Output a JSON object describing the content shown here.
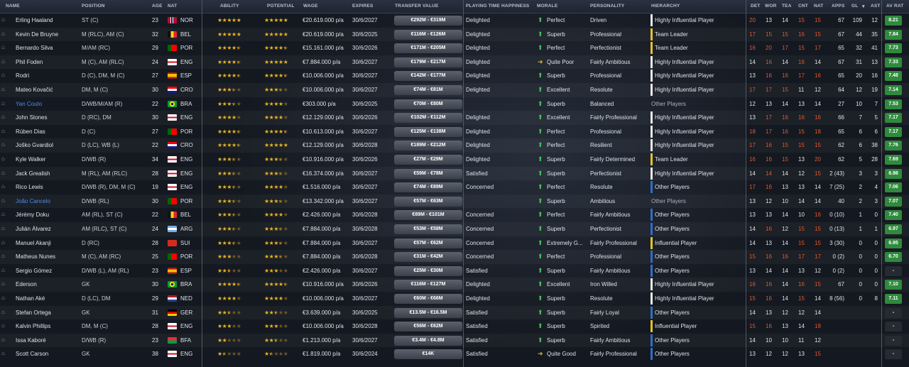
{
  "columns": {
    "name": "NAME",
    "position": "POSITION",
    "age": "AGE",
    "nat": "NAT",
    "ability": "ABILITY",
    "potential": "POTENTIAL",
    "wage": "WAGE",
    "expires": "EXPIRES",
    "transfer_value": "TRANSFER VALUE",
    "pt_happiness": "PLAYING TIME HAPPINESS",
    "morale": "MORALE",
    "personality": "PERSONALITY",
    "hierarchy": "HIERARCHY",
    "det": "DET",
    "wor": "WOR",
    "tea": "TEA",
    "cnt": "CNT",
    "nat2": "NAT",
    "apps": "APPS",
    "gls": "GL",
    "ast": "AST",
    "av_rat": "AV RAT"
  },
  "colors": {
    "star": "#e6b423",
    "arrow_up": "#4fc25a",
    "arrow_side": "#d8b32c",
    "bar_white": "#e8e8e8",
    "bar_yellow": "#e3c32c",
    "bar_blue": "#2f6fc6",
    "attr_red": "#e2592f",
    "rating_green": "#2f8a3d",
    "rating_dark": "#252b33",
    "link": "#4a8fe8"
  },
  "players": [
    {
      "name": "Erling Haaland",
      "pos": "ST (C)",
      "age": "23",
      "flag": "NOR",
      "nat": "NOR",
      "ab": 5,
      "pot": 5,
      "wage": "€20.619.000 p/a",
      "exp": "30/6/2027",
      "tv": "€292M - €319M",
      "pth": "Delighted",
      "mor": "Perfect",
      "arrow": "up",
      "pers": "Driven",
      "hier": "Highly Influential Player",
      "bar": "white",
      "det": "20",
      "wor": "13",
      "tea": "14",
      "cnt": "15",
      "nat2": "15",
      "apps": "67",
      "gls": "109",
      "ast": "12",
      "rat": "8.21",
      "red": [
        1,
        0,
        0,
        1,
        1
      ],
      "link": false
    },
    {
      "name": "Kevin De Bruyne",
      "pos": "M (RLC), AM (C)",
      "age": "32",
      "flag": "BEL",
      "nat": "BEL",
      "ab": 5,
      "pot": 5,
      "wage": "€20.619.000 p/a",
      "exp": "30/6/2025",
      "tv": "€116M - €126M",
      "pth": "Delighted",
      "mor": "Superb",
      "arrow": "up",
      "pers": "Professional",
      "hier": "Team Leader",
      "bar": "yellow",
      "det": "17",
      "wor": "15",
      "tea": "15",
      "cnt": "16",
      "nat2": "15",
      "apps": "67",
      "gls": "44",
      "ast": "35",
      "rat": "7.84",
      "red": [
        1,
        1,
        1,
        1,
        1
      ],
      "link": false
    },
    {
      "name": "Bernardo Silva",
      "pos": "M/AM (RC)",
      "age": "29",
      "flag": "POR",
      "nat": "POR",
      "ab": 4.5,
      "pot": 4.5,
      "wage": "€15.161.000 p/a",
      "exp": "30/6/2026",
      "tv": "€171M - €205M",
      "pth": "Delighted",
      "mor": "Perfect",
      "arrow": "up",
      "pers": "Perfectionist",
      "hier": "Team Leader",
      "bar": "yellow",
      "det": "16",
      "wor": "20",
      "tea": "17",
      "cnt": "15",
      "nat2": "17",
      "apps": "65",
      "gls": "32",
      "ast": "41",
      "rat": "7.73",
      "red": [
        1,
        1,
        1,
        1,
        1
      ],
      "link": false
    },
    {
      "name": "Phil Foden",
      "pos": "M (C), AM (RLC)",
      "age": "24",
      "flag": "ENG",
      "nat": "ENG",
      "ab": 4.5,
      "pot": 5,
      "wage": "€7.884.000 p/a",
      "exp": "30/6/2027",
      "tv": "€179M - €217M",
      "pth": "Delighted",
      "mor": "Quite Poor",
      "arrow": "side",
      "pers": "Fairly Ambitious",
      "hier": "Highly Influential Player",
      "bar": "white",
      "det": "14",
      "wor": "16",
      "tea": "14",
      "cnt": "16",
      "nat2": "14",
      "apps": "67",
      "gls": "31",
      "ast": "13",
      "rat": "7.33",
      "red": [
        0,
        1,
        0,
        1,
        0
      ],
      "link": false
    },
    {
      "name": "Rodri",
      "pos": "D (C), DM, M (C)",
      "age": "27",
      "flag": "ESP",
      "nat": "ESP",
      "ab": 4.5,
      "pot": 4.5,
      "wage": "€10.006.000 p/a",
      "exp": "30/6/2027",
      "tv": "€142M - €177M",
      "pth": "Delighted",
      "mor": "Superb",
      "arrow": "up",
      "pers": "Professional",
      "hier": "Highly Influential Player",
      "bar": "white",
      "det": "13",
      "wor": "16",
      "tea": "16",
      "cnt": "17",
      "nat2": "16",
      "apps": "65",
      "gls": "20",
      "ast": "16",
      "rat": "7.48",
      "red": [
        0,
        1,
        1,
        1,
        1
      ],
      "link": false
    },
    {
      "name": "Mateo Kovačić",
      "pos": "DM, M (C)",
      "age": "30",
      "flag": "CRO",
      "nat": "CRO",
      "ab": 3.5,
      "pot": 3.5,
      "wage": "€10.006.000 p/a",
      "exp": "30/6/2027",
      "tv": "€74M - €81M",
      "pth": "Delighted",
      "mor": "Excellent",
      "arrow": "up",
      "pers": "Resolute",
      "hier": "Highly Influential Player",
      "bar": "white",
      "det": "17",
      "wor": "17",
      "tea": "15",
      "cnt": "11",
      "nat2": "12",
      "apps": "64",
      "gls": "12",
      "ast": "19",
      "rat": "7.14",
      "red": [
        1,
        1,
        1,
        0,
        0
      ],
      "link": false
    },
    {
      "name": "Yan Couto",
      "pos": "D/WB/M/AM (R)",
      "age": "22",
      "flag": "BRA",
      "nat": "BRA",
      "ab": 3.5,
      "pot": 4,
      "wage": "€303.000 p/a",
      "exp": "30/6/2025",
      "tv": "€70M - €80M",
      "pth": "",
      "mor": "Superb",
      "arrow": "up",
      "pers": "Balanced",
      "hier": "Other Players",
      "bar": "none",
      "det": "12",
      "wor": "13",
      "tea": "14",
      "cnt": "13",
      "nat2": "14",
      "apps": "27",
      "gls": "10",
      "ast": "7",
      "rat": "7.53",
      "red": [
        0,
        0,
        0,
        0,
        0
      ],
      "link": true
    },
    {
      "name": "John Stones",
      "pos": "D (RC), DM",
      "age": "30",
      "flag": "ENG",
      "nat": "ENG",
      "ab": 4,
      "pot": 4,
      "wage": "€12.129.000 p/a",
      "exp": "30/6/2026",
      "tv": "€102M - €112M",
      "pth": "Delighted",
      "mor": "Excellent",
      "arrow": "up",
      "pers": "Fairly Professional",
      "hier": "Highly Influential Player",
      "bar": "white",
      "det": "13",
      "wor": "17",
      "tea": "16",
      "cnt": "16",
      "nat2": "16",
      "apps": "66",
      "gls": "7",
      "ast": "5",
      "rat": "7.17",
      "red": [
        0,
        1,
        1,
        1,
        1
      ],
      "link": false
    },
    {
      "name": "Rúben Dias",
      "pos": "D (C)",
      "age": "27",
      "flag": "POR",
      "nat": "POR",
      "ab": 4.5,
      "pot": 4.5,
      "wage": "€10.613.000 p/a",
      "exp": "30/6/2027",
      "tv": "€125M - €138M",
      "pth": "Delighted",
      "mor": "Perfect",
      "arrow": "up",
      "pers": "Professional",
      "hier": "Highly Influential Player",
      "bar": "white",
      "det": "18",
      "wor": "17",
      "tea": "16",
      "cnt": "15",
      "nat2": "18",
      "apps": "65",
      "gls": "6",
      "ast": "6",
      "rat": "7.17",
      "red": [
        1,
        1,
        1,
        1,
        1
      ],
      "link": false
    },
    {
      "name": "Joško Gvardiol",
      "pos": "D (LC), WB (L)",
      "age": "22",
      "flag": "CRO",
      "nat": "CRO",
      "ab": 4.5,
      "pot": 5,
      "wage": "€12.129.000 p/a",
      "exp": "30/6/2028",
      "tv": "€189M - €212M",
      "pth": "Delighted",
      "mor": "Perfect",
      "arrow": "up",
      "pers": "Resilient",
      "hier": "Highly Influential Player",
      "bar": "white",
      "det": "17",
      "wor": "16",
      "tea": "15",
      "cnt": "15",
      "nat2": "15",
      "apps": "62",
      "gls": "6",
      "ast": "38",
      "rat": "7.76",
      "red": [
        1,
        1,
        1,
        1,
        1
      ],
      "link": false
    },
    {
      "name": "Kyle Walker",
      "pos": "D/WB (R)",
      "age": "34",
      "flag": "ENG",
      "nat": "ENG",
      "ab": 3.5,
      "pot": 3.5,
      "wage": "€10.916.000 p/a",
      "exp": "30/6/2026",
      "tv": "€27M - €29M",
      "pth": "Delighted",
      "mor": "Superb",
      "arrow": "up",
      "pers": "Fairly Determined",
      "hier": "Team Leader",
      "bar": "yellow",
      "det": "16",
      "wor": "16",
      "tea": "15",
      "cnt": "13",
      "nat2": "20",
      "apps": "62",
      "gls": "5",
      "ast": "28",
      "rat": "7.69",
      "red": [
        1,
        1,
        1,
        0,
        1
      ],
      "link": false
    },
    {
      "name": "Jack Grealish",
      "pos": "M (RL), AM (RLC)",
      "age": "28",
      "flag": "ENG",
      "nat": "ENG",
      "ab": 3.5,
      "pot": 3.5,
      "wage": "€16.374.000 p/a",
      "exp": "30/6/2027",
      "tv": "€59M - €78M",
      "pth": "Satisfied",
      "mor": "Superb",
      "arrow": "up",
      "pers": "Perfectionist",
      "hier": "Highly Influential Player",
      "bar": "white",
      "det": "14",
      "wor": "14",
      "tea": "14",
      "cnt": "12",
      "nat2": "15",
      "apps": "2 (43)",
      "gls": "3",
      "ast": "3",
      "rat": "6.98",
      "red": [
        0,
        1,
        0,
        0,
        1
      ],
      "link": false
    },
    {
      "name": "Rico Lewis",
      "pos": "D/WB (R), DM, M (C)",
      "age": "19",
      "flag": "ENG",
      "nat": "ENG",
      "ab": 3.5,
      "pot": 4,
      "wage": "€1.516.000 p/a",
      "exp": "30/6/2027",
      "tv": "€74M - €89M",
      "pth": "Concerned",
      "mor": "Perfect",
      "arrow": "up",
      "pers": "Resolute",
      "hier": "Other Players",
      "bar": "blue",
      "det": "17",
      "wor": "16",
      "tea": "13",
      "cnt": "13",
      "nat2": "14",
      "apps": "7 (25)",
      "gls": "2",
      "ast": "4",
      "rat": "7.06",
      "red": [
        1,
        1,
        0,
        0,
        0
      ],
      "link": false
    },
    {
      "name": "João Cancelo",
      "pos": "D/WB (RL)",
      "age": "30",
      "flag": "POR",
      "nat": "POR",
      "ab": 3.5,
      "pot": 3.5,
      "wage": "€13.342.000 p/a",
      "exp": "30/6/2027",
      "tv": "€57M - €63M",
      "pth": "",
      "mor": "Superb",
      "arrow": "up",
      "pers": "Ambitious",
      "hier": "Other Players",
      "bar": "none",
      "det": "13",
      "wor": "12",
      "tea": "10",
      "cnt": "14",
      "nat2": "14",
      "apps": "40",
      "gls": "2",
      "ast": "3",
      "rat": "7.07",
      "red": [
        0,
        0,
        0,
        0,
        0
      ],
      "link": true
    },
    {
      "name": "Jérémy Doku",
      "pos": "AM (RL), ST (C)",
      "age": "22",
      "flag": "BEL",
      "nat": "BEL",
      "ab": 3.5,
      "pot": 4,
      "wage": "€2.426.000 p/a",
      "exp": "30/6/2028",
      "tv": "€89M - €101M",
      "pth": "Concerned",
      "mor": "Perfect",
      "arrow": "up",
      "pers": "Fairly Ambitious",
      "hier": "Other Players",
      "bar": "blue",
      "det": "13",
      "wor": "13",
      "tea": "14",
      "cnt": "10",
      "nat2": "16",
      "apps": "0 (10)",
      "gls": "1",
      "ast": "0",
      "rat": "7.40",
      "red": [
        0,
        0,
        0,
        0,
        1
      ],
      "link": false
    },
    {
      "name": "Julián Álvarez",
      "pos": "AM (RLC), ST (C)",
      "age": "24",
      "flag": "ARG",
      "nat": "ARG",
      "ab": 3.5,
      "pot": 3.5,
      "wage": "€7.884.000 p/a",
      "exp": "30/6/2028",
      "tv": "€53M - €58M",
      "pth": "Concerned",
      "mor": "Superb",
      "arrow": "up",
      "pers": "Perfectionist",
      "hier": "Other Players",
      "bar": "blue",
      "det": "14",
      "wor": "16",
      "tea": "12",
      "cnt": "15",
      "nat2": "15",
      "apps": "0 (13)",
      "gls": "1",
      "ast": "1",
      "rat": "6.97",
      "red": [
        0,
        1,
        0,
        1,
        1
      ],
      "link": false
    },
    {
      "name": "Manuel Akanji",
      "pos": "D (RC)",
      "age": "28",
      "flag": "SUI",
      "nat": "SUI",
      "ab": 3.5,
      "pot": 3.5,
      "wage": "€7.884.000 p/a",
      "exp": "30/6/2027",
      "tv": "€57M - €62M",
      "pth": "Concerned",
      "mor": "Extremely G...",
      "arrow": "up",
      "pers": "Fairly Professional",
      "hier": "Influential Player",
      "bar": "yellow",
      "det": "14",
      "wor": "13",
      "tea": "14",
      "cnt": "15",
      "nat2": "15",
      "apps": "3 (30)",
      "gls": "0",
      "ast": "0",
      "rat": "6.95",
      "red": [
        0,
        0,
        0,
        1,
        1
      ],
      "link": false
    },
    {
      "name": "Matheus Nunes",
      "pos": "M (C), AM (RC)",
      "age": "25",
      "flag": "POR",
      "nat": "POR",
      "ab": 3,
      "pot": 3.5,
      "wage": "€7.884.000 p/a",
      "exp": "30/6/2028",
      "tv": "€31M - €42M",
      "pth": "Concerned",
      "mor": "Perfect",
      "arrow": "up",
      "pers": "Professional",
      "hier": "Other Players",
      "bar": "blue",
      "det": "15",
      "wor": "16",
      "tea": "16",
      "cnt": "17",
      "nat2": "17",
      "apps": "0 (2)",
      "gls": "0",
      "ast": "0",
      "rat": "6.70",
      "red": [
        1,
        1,
        1,
        1,
        1
      ],
      "link": false
    },
    {
      "name": "Sergio Gómez",
      "pos": "D/WB (L), AM (RL)",
      "age": "23",
      "flag": "ESP",
      "nat": "ESP",
      "ab": 2.5,
      "pot": 3,
      "wage": "€2.426.000 p/a",
      "exp": "30/6/2027",
      "tv": "€25M - €30M",
      "pth": "Satisfied",
      "mor": "Superb",
      "arrow": "up",
      "pers": "Fairly Ambitious",
      "hier": "Other Players",
      "bar": "blue",
      "det": "13",
      "wor": "14",
      "tea": "14",
      "cnt": "13",
      "nat2": "12",
      "apps": "0 (2)",
      "gls": "0",
      "ast": "0",
      "rat": "-",
      "red": [
        0,
        0,
        0,
        0,
        0
      ],
      "link": false
    },
    {
      "name": "Ederson",
      "pos": "GK",
      "age": "30",
      "flag": "BRA",
      "nat": "BRA",
      "ab": 4.5,
      "pot": 4.5,
      "wage": "€10.916.000 p/a",
      "exp": "30/6/2026",
      "tv": "€116M - €127M",
      "pth": "Delighted",
      "mor": "Excellent",
      "arrow": "up",
      "pers": "Iron Willed",
      "hier": "Highly Influential Player",
      "bar": "white",
      "det": "16",
      "wor": "16",
      "tea": "14",
      "cnt": "16",
      "nat2": "15",
      "apps": "67",
      "gls": "0",
      "ast": "0",
      "rat": "7.10",
      "red": [
        1,
        1,
        0,
        1,
        1
      ],
      "link": false
    },
    {
      "name": "Nathan Aké",
      "pos": "D (LC), DM",
      "age": "29",
      "flag": "NED",
      "nat": "NED",
      "ab": 4,
      "pot": 4,
      "wage": "€10.006.000 p/a",
      "exp": "30/6/2027",
      "tv": "€60M - €66M",
      "pth": "Delighted",
      "mor": "Superb",
      "arrow": "up",
      "pers": "Resolute",
      "hier": "Highly Influential Player",
      "bar": "white",
      "det": "15",
      "wor": "16",
      "tea": "14",
      "cnt": "15",
      "nat2": "14",
      "apps": "8 (56)",
      "gls": "0",
      "ast": "8",
      "rat": "7.11",
      "red": [
        1,
        1,
        0,
        1,
        0
      ],
      "link": false
    },
    {
      "name": "Stefan Ortega",
      "pos": "GK",
      "age": "31",
      "flag": "GER",
      "nat": "GER",
      "ab": 2.5,
      "pot": 2.5,
      "wage": "€3.639.000 p/a",
      "exp": "30/6/2025",
      "tv": "€13.5M - €16.5M",
      "pth": "Satisfied",
      "mor": "Superb",
      "arrow": "up",
      "pers": "Fairly Loyal",
      "hier": "Other Players",
      "bar": "blue",
      "det": "14",
      "wor": "13",
      "tea": "12",
      "cnt": "12",
      "nat2": "14",
      "apps": "",
      "gls": "",
      "ast": "",
      "rat": "-",
      "red": [
        0,
        0,
        0,
        0,
        0
      ],
      "link": false
    },
    {
      "name": "Kalvin Phillips",
      "pos": "DM, M (C)",
      "age": "28",
      "flag": "ENG",
      "nat": "ENG",
      "ab": 3,
      "pot": 3,
      "wage": "€10.006.000 p/a",
      "exp": "30/6/2028",
      "tv": "€56M - €62M",
      "pth": "Satisfied",
      "mor": "Superb",
      "arrow": "up",
      "pers": "Spirited",
      "hier": "Influential Player",
      "bar": "yellow",
      "det": "15",
      "wor": "16",
      "tea": "13",
      "cnt": "14",
      "nat2": "18",
      "apps": "",
      "gls": "",
      "ast": "",
      "rat": "-",
      "red": [
        1,
        1,
        0,
        0,
        1
      ],
      "link": false
    },
    {
      "name": "Issa Kaboré",
      "pos": "D/WB (R)",
      "age": "23",
      "flag": "BFA",
      "nat": "BFA",
      "ab": 2,
      "pot": 2.5,
      "wage": "€1.213.000 p/a",
      "exp": "30/6/2027",
      "tv": "€3.4M - €4.8M",
      "pth": "Satisfied",
      "mor": "Superb",
      "arrow": "up",
      "pers": "Fairly Ambitious",
      "hier": "Other Players",
      "bar": "blue",
      "det": "14",
      "wor": "10",
      "tea": "10",
      "cnt": "11",
      "nat2": "12",
      "apps": "",
      "gls": "",
      "ast": "",
      "rat": "-",
      "red": [
        0,
        0,
        0,
        0,
        0
      ],
      "link": false
    },
    {
      "name": "Scott Carson",
      "pos": "GK",
      "age": "38",
      "flag": "ENG",
      "nat": "ENG",
      "ab": 1.5,
      "pot": 1.5,
      "wage": "€1.819.000 p/a",
      "exp": "30/6/2024",
      "tv": "€14K",
      "pth": "Satisfied",
      "mor": "Quite Good",
      "arrow": "side",
      "pers": "Fairly Professional",
      "hier": "Other Players",
      "bar": "blue",
      "det": "13",
      "wor": "12",
      "tea": "12",
      "cnt": "13",
      "nat2": "15",
      "apps": "",
      "gls": "",
      "ast": "",
      "rat": "-",
      "red": [
        0,
        0,
        0,
        0,
        1
      ],
      "link": false
    }
  ]
}
